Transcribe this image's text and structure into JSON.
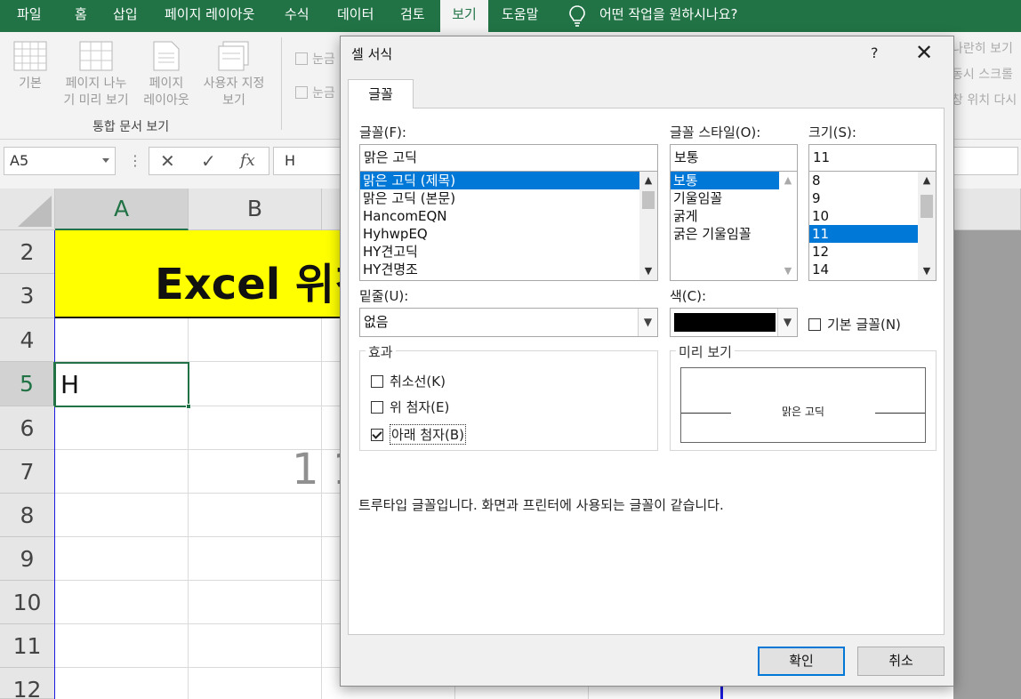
{
  "ribbon_tabs": [
    {
      "label": "파일"
    },
    {
      "label": "홈"
    },
    {
      "label": "삽입"
    },
    {
      "label": "페이지 레이아웃"
    },
    {
      "label": "수식"
    },
    {
      "label": "데이터"
    },
    {
      "label": "검토"
    },
    {
      "label": "보기"
    },
    {
      "label": "도움말"
    }
  ],
  "tell_me": "어떤 작업을 원하시나요?",
  "ribbon": {
    "views": [
      {
        "line1": "기본",
        "line2": ""
      },
      {
        "line1": "페이지 나누",
        "line2": "기 미리 보기"
      },
      {
        "line1": "페이지",
        "line2": "레이아웃"
      },
      {
        "line1": "사용자 지정",
        "line2": "보기"
      }
    ],
    "group_label": "통합 문서 보기",
    "check1": "눈금",
    "check2": "눈금",
    "right1": "나란히 보기",
    "right2": "동시 스크롤",
    "right3": "창 위치 다시"
  },
  "formula_bar": {
    "name_box": "A5",
    "dots": "⋮",
    "cancel": "✕",
    "enter": "✓",
    "fx": "fx",
    "value": "H"
  },
  "sheet": {
    "columns": [
      "A",
      "B"
    ],
    "rows": [
      "2",
      "3",
      "4",
      "5",
      "6",
      "7",
      "8",
      "9",
      "10",
      "11",
      "12"
    ],
    "banner_text": "Excel 위칭",
    "cell_a5": "H",
    "partial_text": "1 1"
  },
  "dialog": {
    "title": "셀 서식",
    "help": "?",
    "close": "✕",
    "tab": "글꼴",
    "font_label": "글꼴(F):",
    "font_value": "맑은 고딕",
    "font_list": [
      "맑은 고딕 (제목)",
      "맑은 고딕 (본문)",
      "HancomEQN",
      "HyhwpEQ",
      "HY견고딕",
      "HY견명조"
    ],
    "style_label": "글꼴 스타일(O):",
    "style_value": "보통",
    "style_list": [
      "보통",
      "기울임꼴",
      "굵게",
      "굵은 기울임꼴"
    ],
    "size_label": "크기(S):",
    "size_value": "11",
    "size_list": [
      "8",
      "9",
      "10",
      "11",
      "12",
      "14"
    ],
    "underline_label": "밑줄(U):",
    "underline_value": "없음",
    "color_label": "색(C):",
    "color_value": "#000000",
    "normal_font": "기본 글꼴(N)",
    "effects_label": "효과",
    "strikethrough": "취소선(K)",
    "superscript": "위 첨자(E)",
    "subscript": "아래 첨자(B)",
    "preview_label": "미리 보기",
    "preview_text": "맑은 고딕",
    "info": "트루타입 글꼴입니다. 화면과 프린터에 사용되는 글꼴이 같습니다.",
    "ok": "확인",
    "cancel": "취소"
  }
}
